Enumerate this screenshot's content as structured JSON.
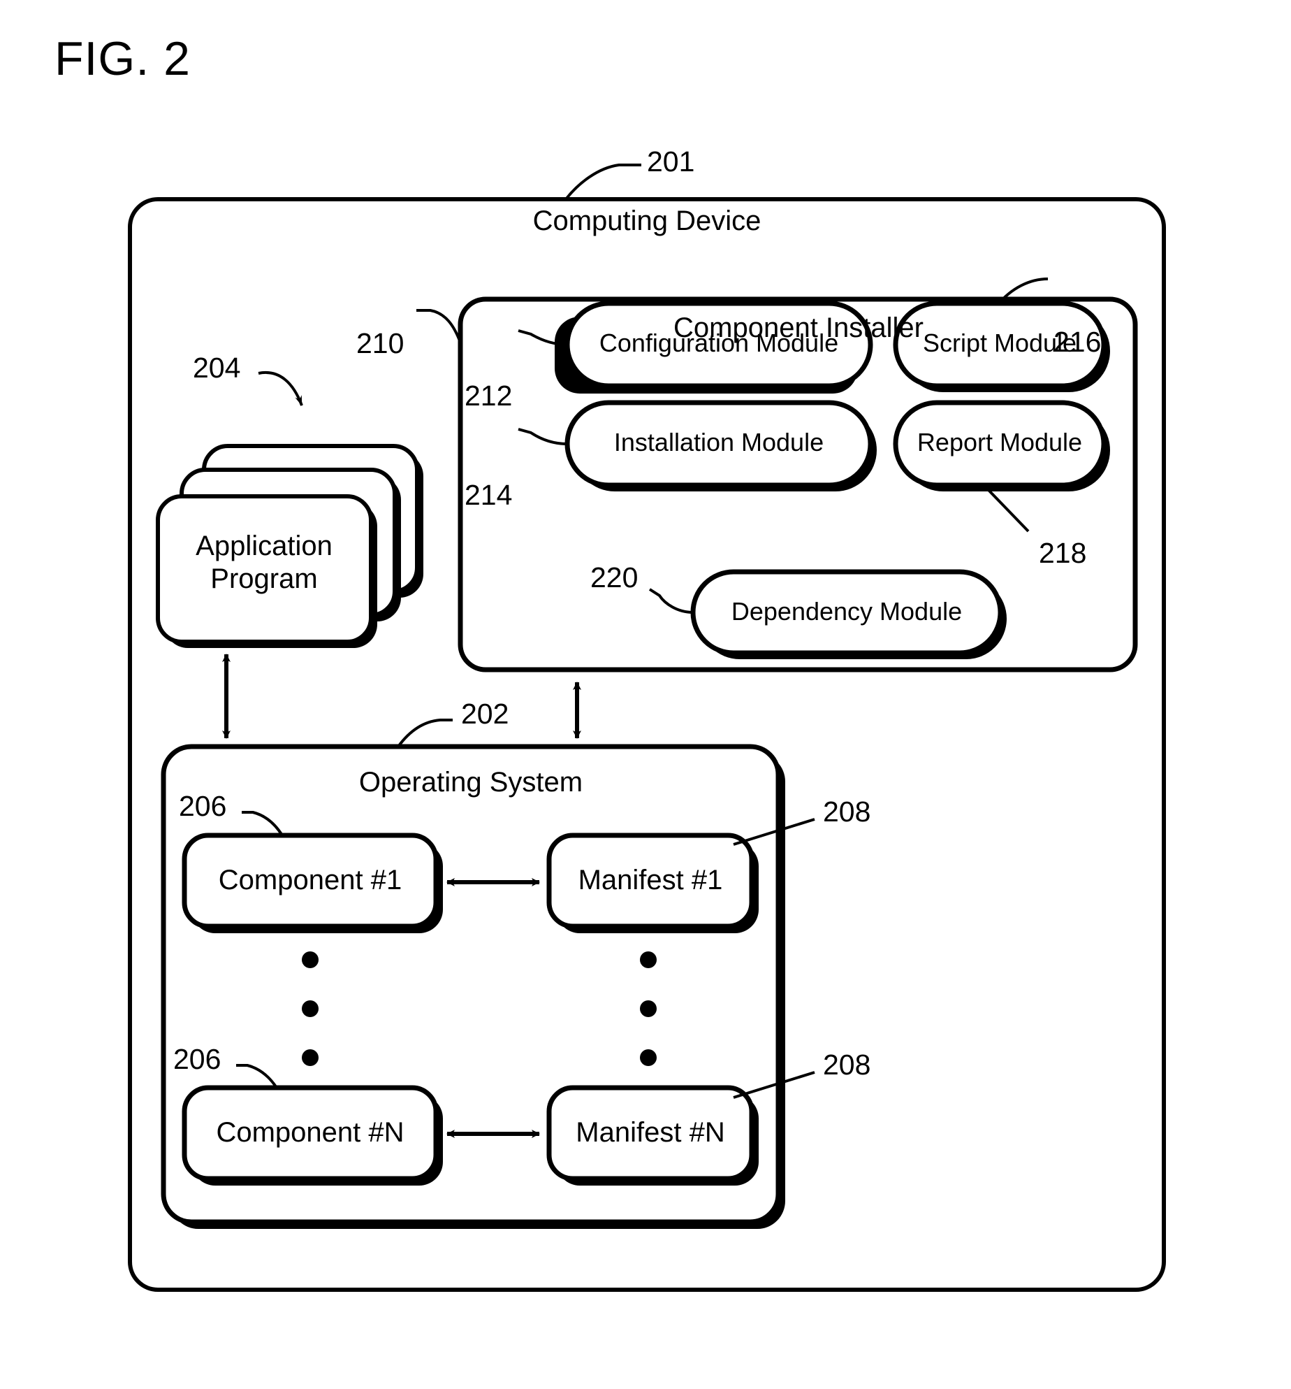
{
  "figure": {
    "title": "FIG. 2"
  },
  "computing_device": {
    "ref": "201",
    "title": "Computing Device"
  },
  "application_program": {
    "ref": "204",
    "label_line1": "Application",
    "label_line2": "Program",
    "stack_count": 3
  },
  "component_installer": {
    "ref": "210",
    "title": "Component Installer",
    "modules": [
      {
        "ref": "212",
        "label": "Configuration Module"
      },
      {
        "ref": "216",
        "label": "Script Module"
      },
      {
        "ref": "214",
        "label": "Installation Module"
      },
      {
        "ref": "218",
        "label": "Report Module"
      },
      {
        "ref": "220",
        "label": "Dependency Module"
      }
    ]
  },
  "operating_system": {
    "ref": "202",
    "title": "Operating System",
    "rows": [
      {
        "component": {
          "ref": "206",
          "label": "Component #1"
        },
        "manifest": {
          "ref": "208",
          "label": "Manifest #1"
        }
      },
      {
        "component": {
          "ref": "206",
          "label": "Component #N"
        },
        "manifest": {
          "ref": "208",
          "label": "Manifest #N"
        }
      }
    ],
    "ellipsis_dots": 3
  },
  "connectors": [
    {
      "name": "app-to-os",
      "type": "double-arrow-vertical"
    },
    {
      "name": "installer-to-os",
      "type": "double-arrow-vertical"
    },
    {
      "name": "component1-to-manifest1",
      "type": "double-arrow-horizontal"
    },
    {
      "name": "componentN-to-manifestN",
      "type": "double-arrow-horizontal"
    }
  ],
  "colors": {
    "stroke": "#000000",
    "fill": "#ffffff",
    "background": "#ffffff"
  }
}
